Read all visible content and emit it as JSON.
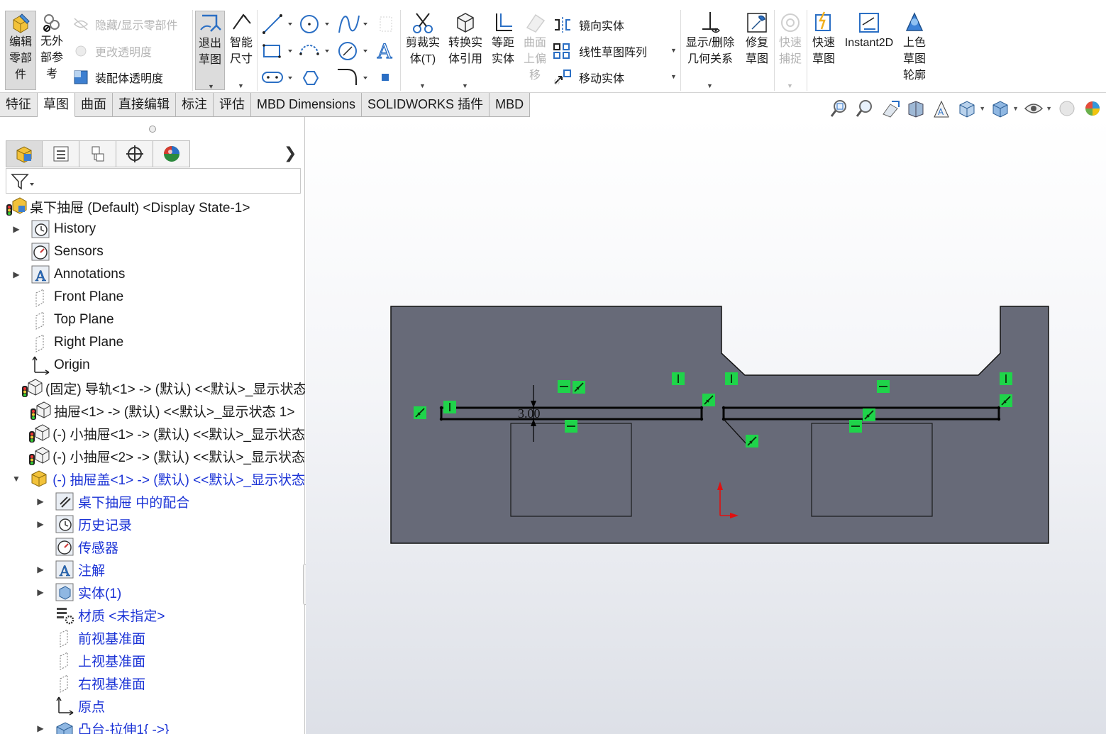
{
  "ribbon": {
    "edit_component": "编辑\n零部\n件",
    "no_external_ref": "无外\n部参\n考",
    "hide_show_components": "隐藏/显示零部件",
    "change_transparency": "更改透明度",
    "assembly_transparency": "装配体透明度",
    "exit_sketch": "退出\n草图",
    "smart_dimension": "智能\n尺寸",
    "trim_entities": "剪裁实\n体(T)",
    "convert_entities": "转换实\n体引用",
    "offset_entities": "等距\n实体",
    "surface_offset": "曲面\n上偏\n移",
    "mirror_entities": "镜向实体",
    "linear_pattern": "线性草图阵列",
    "move_entities": "移动实体",
    "display_delete_relations": "显示/删除\n几何关系",
    "repair_sketch": "修复\n草图",
    "quick_snaps": "快速\n捕捉",
    "rapid_sketch": "快速\n草图",
    "instant2d": "Instant2D",
    "shaded_sketch_contours": "上色\n草图\n轮廓"
  },
  "tabs": [
    "特征",
    "草图",
    "曲面",
    "直接编辑",
    "标注",
    "评估",
    "MBD Dimensions",
    "SOLIDWORKS 插件",
    "MBD"
  ],
  "tabs_selected": "草图",
  "tree": {
    "root": "桌下抽屉 (Default) <Display State-1>",
    "history": "History",
    "sensors": "Sensors",
    "annotations": "Annotations",
    "front_plane": "Front Plane",
    "top_plane": "Top Plane",
    "right_plane": "Right Plane",
    "origin": "Origin",
    "rail": "(固定) 导轨<1> -> (默认) <<默认>_显示状态",
    "drawer": "抽屉<1> -> (默认) <<默认>_显示状态 1>",
    "small_drawer_1": "(-) 小抽屉<1> -> (默认) <<默认>_显示状态",
    "small_drawer_2": "(-) 小抽屉<2> -> (默认) <<默认>_显示状态",
    "drawer_cover": "(-) 抽屉盖<1> -> (默认) <<默认>_显示状态",
    "mates": "桌下抽屉 中的配合",
    "history_cn": "历史记录",
    "sensors_cn": "传感器",
    "annotations_cn": "注解",
    "solid_bodies": "实体(1)",
    "material": "材质 <未指定>",
    "front_plane_cn": "前视基准面",
    "top_plane_cn": "上视基准面",
    "right_plane_cn": "右视基准面",
    "origin_cn": "原点",
    "boss_extrude": "凸台-拉伸1{ ->}"
  },
  "sketch": {
    "dimension": "3.00",
    "face_color": "#676a78",
    "relation_color": "#1fd44a"
  }
}
